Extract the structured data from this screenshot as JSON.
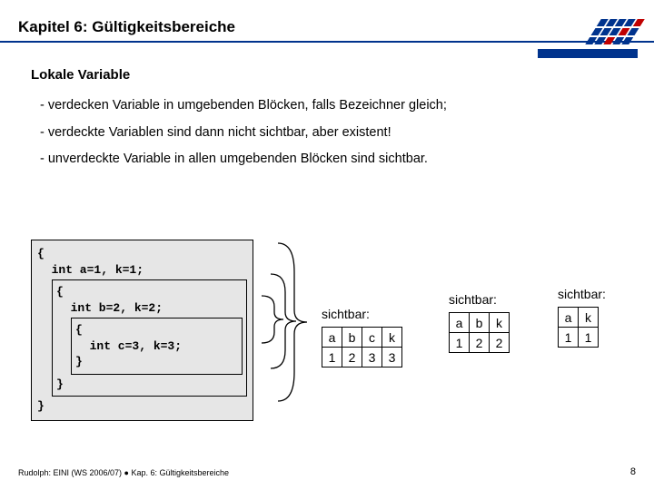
{
  "header": {
    "title": "Kapitel 6: Gültigkeitsbereiche"
  },
  "section_title": "Lokale Variable",
  "bullets": [
    "- verdecken Variable in umgebenden Blöcken, falls Bezeichner gleich;",
    "- verdeckte Variablen sind dann nicht sichtbar, aber existent!",
    "- unverdeckte Variable in allen umgebenden Blöcken sind sichtbar."
  ],
  "code": {
    "open_outer": "{",
    "line_outer": "  int a=1, k=1;",
    "open_mid": "{",
    "line_mid": "  int b=2, k=2;",
    "open_inn": "{",
    "line_inn": "  int c=3, k=3;",
    "close_inn": "}",
    "close_mid": "}",
    "close_outer": "}"
  },
  "tables": {
    "caption": "sichtbar:",
    "t3": {
      "head": [
        "a",
        "b",
        "c",
        "k"
      ],
      "vals": [
        "1",
        "2",
        "3",
        "3"
      ]
    },
    "t2": {
      "head": [
        "a",
        "b",
        "k"
      ],
      "vals": [
        "1",
        "2",
        "2"
      ]
    },
    "t1": {
      "head": [
        "a",
        "k"
      ],
      "vals": [
        "1",
        "1"
      ]
    }
  },
  "footer": {
    "text": "Rudolph: EINI (WS 2006/07)  ●  Kap. 6: Gültigkeitsbereiche",
    "page": "8"
  },
  "chart_data": {
    "type": "table",
    "title": "Variable visibility per nested block scope",
    "scopes": [
      {
        "level": "inner",
        "declares": "int c=3, k=3;",
        "visible": {
          "a": 1,
          "b": 2,
          "c": 3,
          "k": 3
        }
      },
      {
        "level": "middle",
        "declares": "int b=2, k=2;",
        "visible": {
          "a": 1,
          "b": 2,
          "k": 2
        }
      },
      {
        "level": "outer",
        "declares": "int a=1, k=1;",
        "visible": {
          "a": 1,
          "k": 1
        }
      }
    ]
  }
}
